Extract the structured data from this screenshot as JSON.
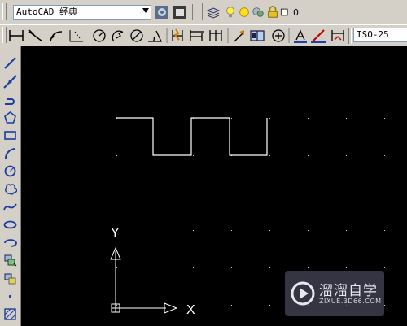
{
  "toolbar_top": {
    "workspace_select": "AutoCAD 经典",
    "layer_value": "0",
    "icons": [
      "workspace-settings-icon",
      "my-workspace-icon",
      "layer-manager-icon",
      "lightbulb-icon",
      "sun-icon",
      "freeze-viewport-icon",
      "lock-icon",
      "color-square-icon"
    ]
  },
  "toolbar_dim": {
    "dimstyle_select": "ISO-25",
    "icons": [
      "linear-dimension-icon",
      "aligned-dimension-icon",
      "arc-length-icon",
      "ordinate-dimension-icon",
      "radius-dimension-icon",
      "jogged-dimension-icon",
      "diameter-dimension-icon",
      "angular-dimension-icon",
      "quick-dimension-icon",
      "baseline-dimension-icon",
      "continue-dimension-icon",
      "quick-leader-icon",
      "tolerance-icon",
      "center-mark-icon",
      "dimension-edit-icon",
      "dimension-text-edit-icon",
      "dimension-update-icon"
    ]
  },
  "draw_toolbar": {
    "tools": [
      "line-icon",
      "construction-line-icon",
      "polyline-icon",
      "polygon-icon",
      "rectangle-icon",
      "arc-icon",
      "circle-icon",
      "revision-cloud-icon",
      "spline-icon",
      "ellipse-icon",
      "ellipse-arc-icon",
      "insert-block-icon",
      "make-block-icon",
      "point-icon",
      "hatch-icon"
    ]
  },
  "canvas": {
    "background": "#000000",
    "ucs_x_label": "X",
    "ucs_y_label": "Y",
    "drawing_color": "#ffffff"
  },
  "watermark": {
    "title": "溜溜自学",
    "subtitle": "ZIXUE.3D66.COM"
  }
}
